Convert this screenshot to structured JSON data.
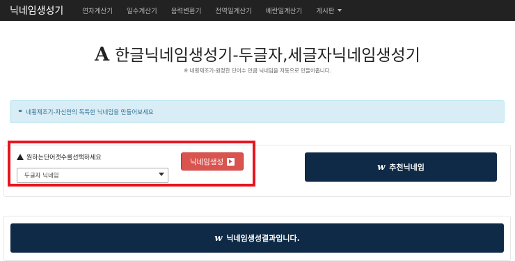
{
  "nav": {
    "brand": "닉네임생성기",
    "items": [
      "연차계산기",
      "일수계산기",
      "음력변환기",
      "전역일계산기",
      "배란일계산기",
      "게시판"
    ]
  },
  "hero": {
    "icon_glyph": "A",
    "title": "한글닉네임생성기-두글자,세글자닉네임생성기",
    "subtitle": "※ 네횡제조기-원정한 단어수 만큼 닉네임을 자동으로 만들어줍니다."
  },
  "alert": {
    "icon_glyph": "⚭",
    "text": "네횡제조기-자신만의 독특한 닉네임을 만들어보세요"
  },
  "form": {
    "label": "원하는단어갯수를선택하세요",
    "select_value": "두글자 닉네임",
    "generate_label": "닉네임생성"
  },
  "recommend": {
    "icon_glyph": "w",
    "label": "추천닉네임"
  },
  "result": {
    "icon_glyph": "w",
    "label": "닉네임생성결과입니다."
  },
  "colors": {
    "navbar": "#222222",
    "dark_button": "#0e2a47",
    "danger_button": "#d9534f",
    "alert_bg": "#d9edf7",
    "highlight_border": "#e8141d"
  }
}
